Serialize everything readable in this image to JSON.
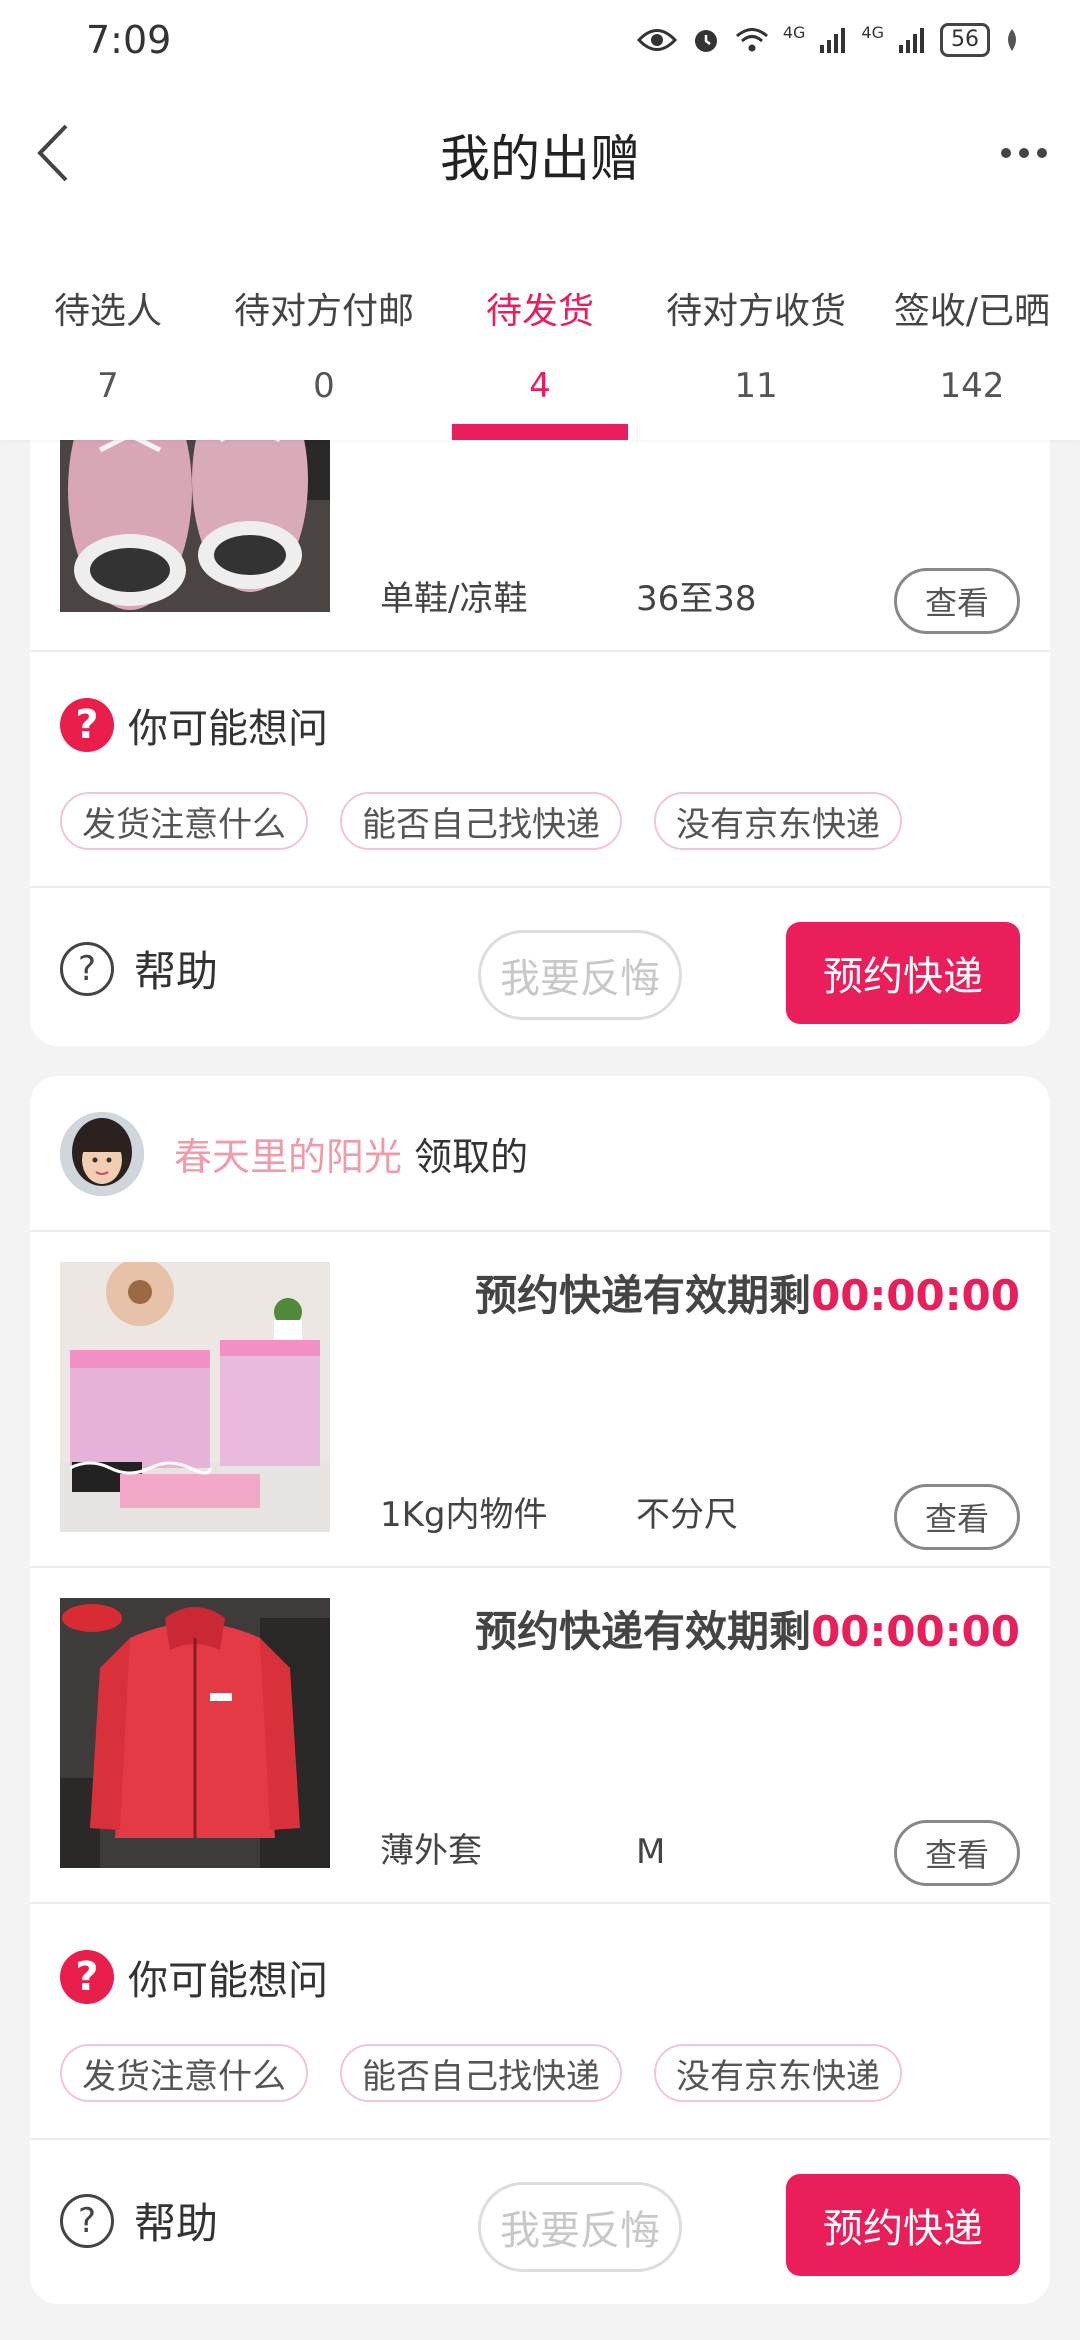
{
  "status_bar": {
    "time": "7:09",
    "signal_label": "4G",
    "battery": "56"
  },
  "header": {
    "title": "我的出赠"
  },
  "tabs": [
    {
      "label": "待选人",
      "count": "7"
    },
    {
      "label": "待对方付邮",
      "count": "0"
    },
    {
      "label": "待发货",
      "count": "4"
    },
    {
      "label": "待对方收货",
      "count": "11"
    },
    {
      "label": "签收/已晒",
      "count": "142"
    }
  ],
  "active_tab": "待发货",
  "colors": {
    "accent": "#e91e5a",
    "recipient": "#f09aaa"
  },
  "card1": {
    "product": {
      "type": "单鞋/凉鞋",
      "size": "36至38",
      "view_label": "查看"
    },
    "faq": {
      "title": "你可能想问",
      "chips": [
        "发货注意什么",
        "能否自己找快递",
        "没有京东快递"
      ]
    },
    "actions": {
      "help": "帮助",
      "regret": "我要反悔",
      "book": "预约快递"
    }
  },
  "card2": {
    "recipient": {
      "name": "春天里的阳光",
      "suffix": "领取的"
    },
    "products": [
      {
        "countdown_label": "预约快递有效期剩",
        "countdown": "00:00:00",
        "type": "1Kg内物件",
        "size": "不分尺",
        "view_label": "查看"
      },
      {
        "countdown_label": "预约快递有效期剩",
        "countdown": "00:00:00",
        "type": "薄外套",
        "size": "M",
        "view_label": "查看"
      }
    ],
    "faq": {
      "title": "你可能想问",
      "chips": [
        "发货注意什么",
        "能否自己找快递",
        "没有京东快递"
      ]
    },
    "actions": {
      "help": "帮助",
      "regret": "我要反悔",
      "book": "预约快递"
    }
  }
}
